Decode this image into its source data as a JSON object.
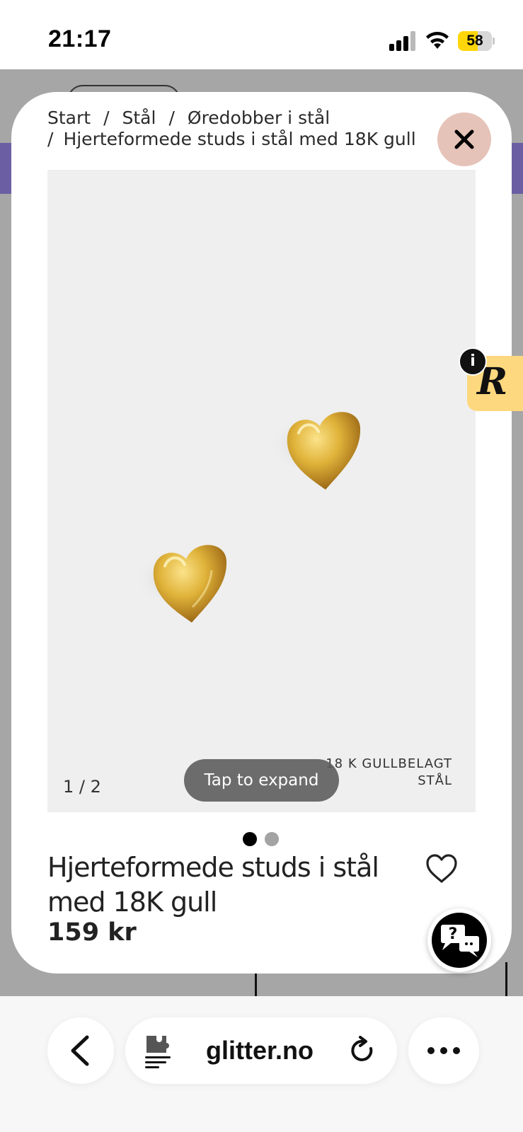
{
  "status_bar": {
    "time": "21:17",
    "battery": "58",
    "battery_level": 0.58,
    "battery_color": "#ffd60a",
    "icons": [
      "cellular-signal-icon",
      "wifi-icon",
      "battery-icon"
    ]
  },
  "modal": {
    "breadcrumb": {
      "items": [
        "Start",
        "Stål",
        "Øredobber i stål",
        "Hjerteformede studs i stål med 18K gull"
      ],
      "separator": "/"
    },
    "close_icon": "close-icon",
    "close_button_color": "#e6c3b8",
    "image": {
      "counter": "1 / 2",
      "material_line1": "18 K GULLBELAGT",
      "material_line2": "STÅL",
      "tap_to_expand": "Tap to expand",
      "background_color": "#efefef"
    },
    "carousel": {
      "total": 2,
      "active_index": 0
    },
    "product": {
      "title": "Hjerteformede studs i stål med 18K gull",
      "price": "159 kr",
      "wishlist_icon": "heart-outline-icon"
    },
    "help_icon": "help-chat-icon"
  },
  "side_widget": {
    "letter": "R",
    "info": "i",
    "color": "#fed87e"
  },
  "browser_bar": {
    "url": "glitter.no",
    "icons": [
      "back-arrow-icon",
      "page-settings-icon",
      "reload-icon",
      "more-icon"
    ]
  }
}
